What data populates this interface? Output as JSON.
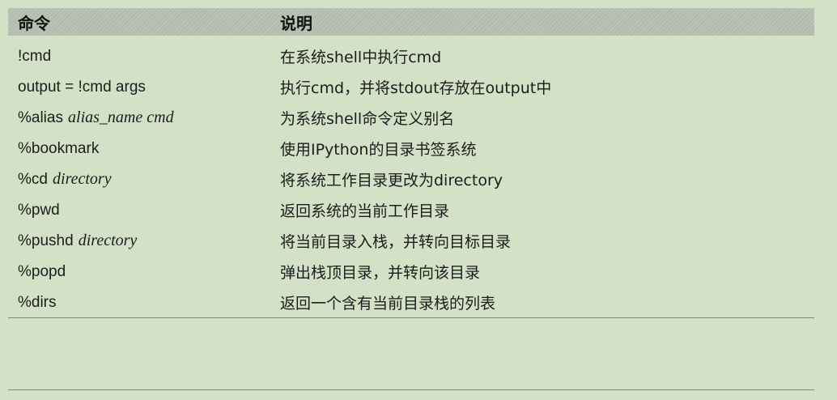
{
  "table": {
    "headers": {
      "command": "命令",
      "description": "说明"
    },
    "rows": [
      {
        "cmd": "!cmd",
        "arg": "",
        "desc": "在系统shell中执行cmd"
      },
      {
        "cmd": "output = !cmd args",
        "arg": "",
        "desc": "执行cmd，并将stdout存放在output中"
      },
      {
        "cmd": "%alias",
        "arg": "alias_name cmd",
        "desc": "为系统shell命令定义别名"
      },
      {
        "cmd": "%bookmark",
        "arg": "",
        "desc": "使用IPython的目录书签系统"
      },
      {
        "cmd": "%cd",
        "arg": "directory",
        "desc": "将系统工作目录更改为directory"
      },
      {
        "cmd": "%pwd",
        "arg": "",
        "desc": "返回系统的当前工作目录"
      },
      {
        "cmd": "%pushd",
        "arg": "directory",
        "desc": "将当前目录入栈，并转向目标目录"
      },
      {
        "cmd": "%popd",
        "arg": "",
        "desc": "弹出栈顶目录，并转向该目录"
      },
      {
        "cmd": "%dirs",
        "arg": "",
        "desc": "返回一个含有当前目录栈的列表"
      }
    ]
  }
}
